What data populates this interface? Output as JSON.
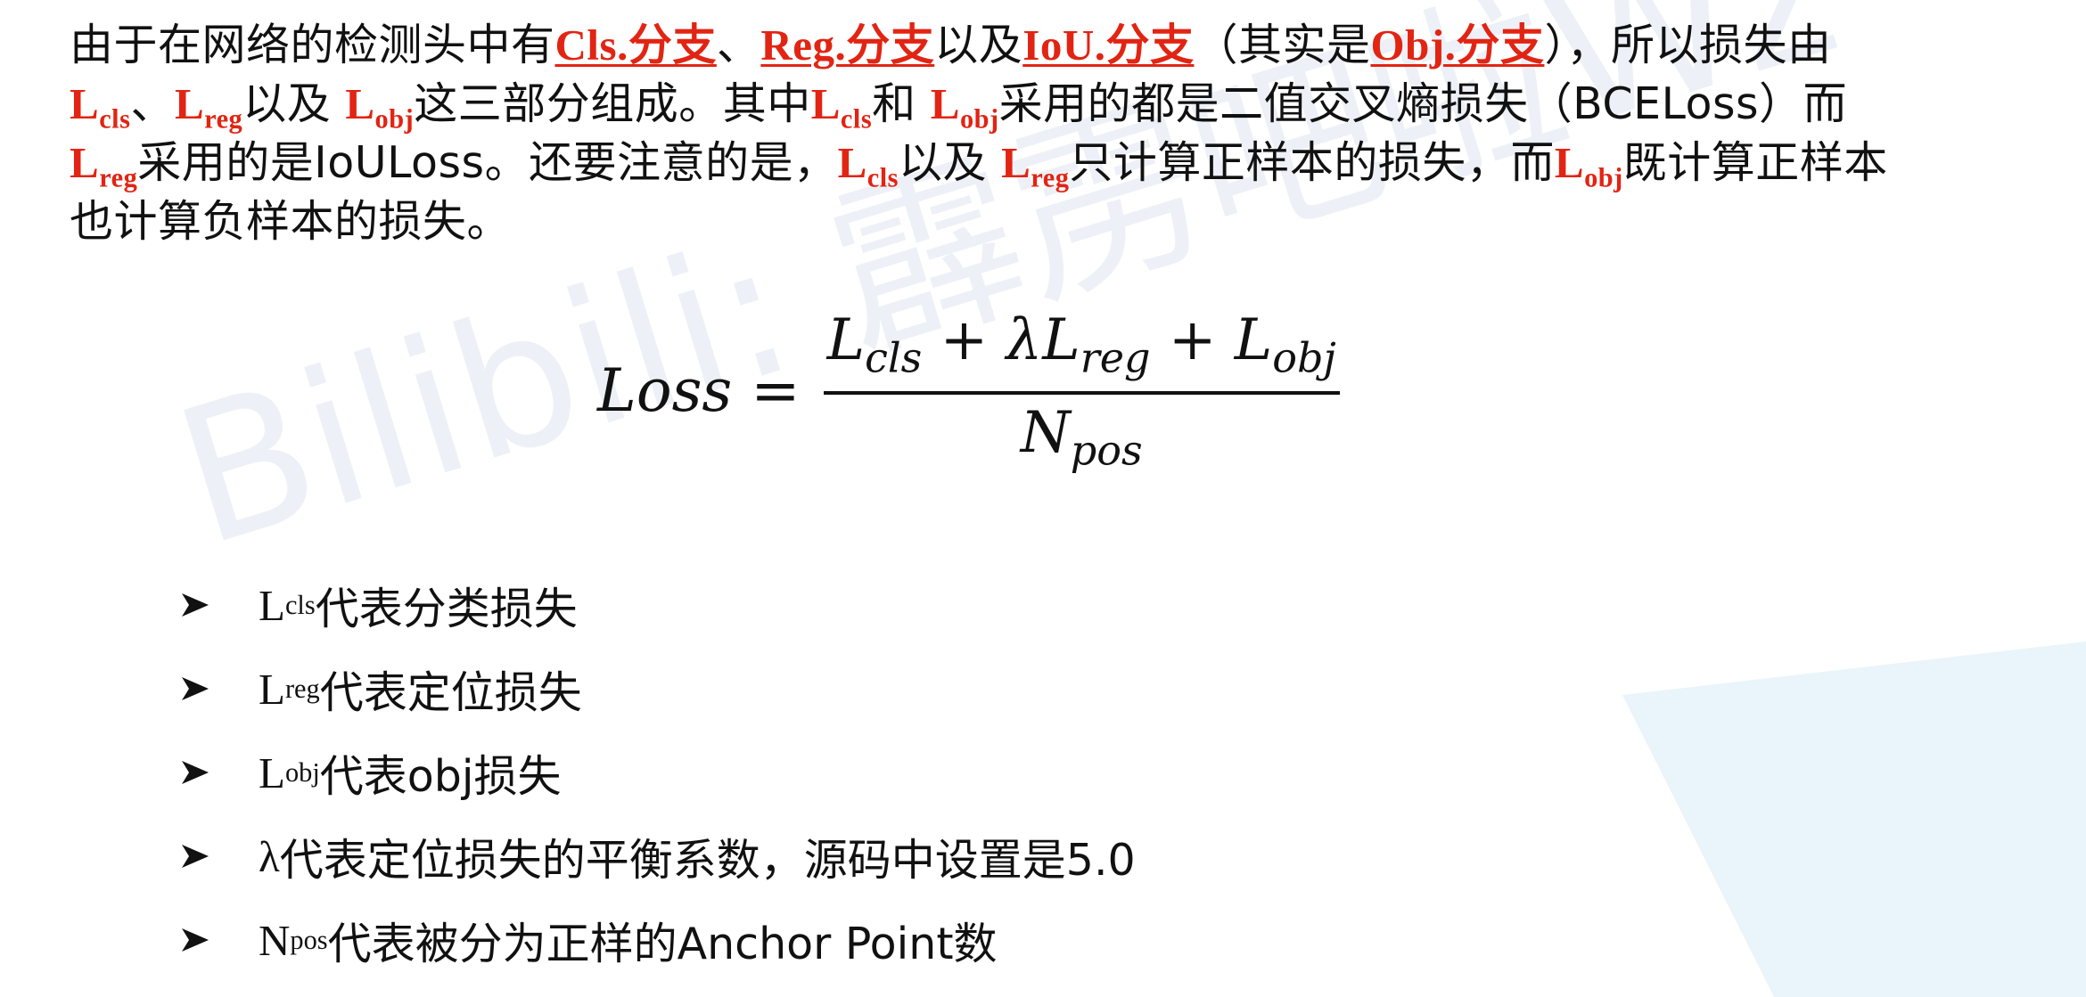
{
  "watermark": "Bilibili: 霹雳吧啦Wz",
  "intro": {
    "l1_a": "由于在网络的检测头中有",
    "cls_branch": "Cls.分支",
    "sep1": "、",
    "reg_branch": "Reg.分支",
    "yiji1": "以及",
    "iou_branch": "IoU.分支",
    "paren_open": "（其实是",
    "obj_branch": "Obj.分支",
    "l1_b": "），所以损失由",
    "L": "L",
    "cls": "cls",
    "reg": "reg",
    "obj": "obj",
    "sep2": "、",
    "yiji2": "以及 ",
    "l2_a": "这三部分组成。其中",
    "he": "和 ",
    "l2_b": "采用的都是二值交叉熵损失（BCELoss）而",
    "l3_a": "采用的是IoULoss。还要注意的是，",
    "yiji3": "以及 ",
    "l3_b": "只计算正样本的损失，而",
    "l3_c": "既计算正样本",
    "l4": "也计算负样本的损失。"
  },
  "formula": {
    "lhs": "Loss",
    "eq": "=",
    "L": "L",
    "cls": "cls",
    "plus": "+",
    "lambda": "λ",
    "reg": "reg",
    "obj": "obj",
    "N": "N",
    "pos": "pos"
  },
  "bullets": [
    {
      "main": "L",
      "sub": "cls",
      "rest": "代表分类损失"
    },
    {
      "main": "L",
      "sub": "reg",
      "rest": "代表定位损失"
    },
    {
      "main": "L",
      "sub": "obj",
      "rest": "代表obj损失"
    },
    {
      "main": "λ",
      "sub": "",
      "rest": "代表定位损失的平衡系数，源码中设置是5.0"
    },
    {
      "main": "N",
      "sub": "pos",
      "rest": "代表被分为正样的Anchor Point数"
    }
  ],
  "colors": {
    "accent_red": "#e22413",
    "watermark": "#dfe7f2",
    "bg_shape": "#eaf4fb"
  },
  "icons": {
    "bullet": "arrowhead-bullet-icon"
  }
}
